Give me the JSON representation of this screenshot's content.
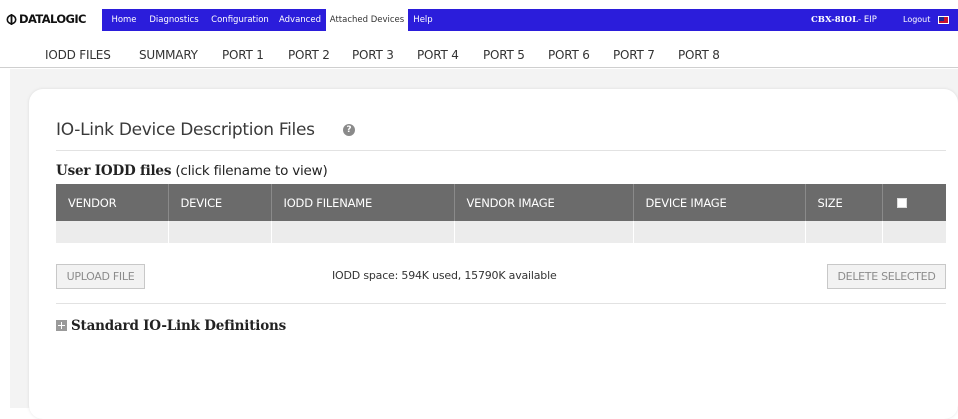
{
  "brand": {
    "logo_text": "DATALOGIC"
  },
  "nav": {
    "items": [
      {
        "label": "Home"
      },
      {
        "label": "Diagnostics"
      },
      {
        "label": "Configuration"
      },
      {
        "label": "Advanced"
      },
      {
        "label": "Attached Devices"
      },
      {
        "label": "Help"
      }
    ],
    "active": "Attached Devices",
    "device_model": "CBX-8IOL",
    "device_suffix": "- EIP",
    "logout_label": "Logout"
  },
  "subtabs": [
    {
      "label": "IODD FILES"
    },
    {
      "label": "SUMMARY"
    },
    {
      "label": "PORT 1"
    },
    {
      "label": "PORT 2"
    },
    {
      "label": "PORT 3"
    },
    {
      "label": "PORT 4"
    },
    {
      "label": "PORT 5"
    },
    {
      "label": "PORT 6"
    },
    {
      "label": "PORT 7"
    },
    {
      "label": "PORT 8"
    }
  ],
  "main": {
    "title": "IO-Link Device Description Files",
    "user_files_label": "User IODD files",
    "user_files_hint": "(click filename to view)",
    "table": {
      "columns": [
        "VENDOR",
        "DEVICE",
        "IODD FILENAME",
        "VENDOR IMAGE",
        "DEVICE IMAGE",
        "SIZE"
      ],
      "rows": [
        [
          "",
          "",
          "",
          "",
          "",
          "",
          ""
        ]
      ]
    },
    "upload_label": "UPLOAD FILE",
    "space_info": "IODD space: 594K used, 15790K available",
    "delete_label": "DELETE SELECTED",
    "standard_defs_label": "Standard IO-Link Definitions"
  },
  "colors": {
    "nav_bar": "#2b1ddb",
    "table_header": "#6b6b6b",
    "page_background": "#f3f3f3"
  },
  "icons": [
    "datalogic-logo-icon",
    "flag-icon",
    "help-icon",
    "checkbox-icon",
    "expand-plus-icon"
  ]
}
